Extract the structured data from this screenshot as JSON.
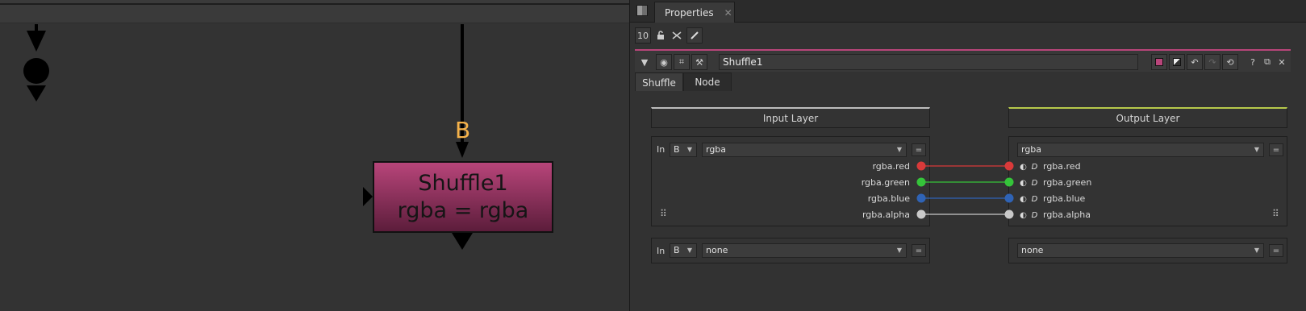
{
  "graph": {
    "input_label": "B",
    "node": {
      "name": "Shuffle1",
      "subtitle": "rgba = rgba"
    }
  },
  "properties": {
    "tab": {
      "label": "Properties",
      "close": "✕"
    },
    "toolbar": {
      "count": "10"
    },
    "node_name": "Shuffle1",
    "subtabs": [
      "Shuffle",
      "Node"
    ],
    "input_layer": {
      "title": "Input Layer"
    },
    "output_layer": {
      "title": "Output Layer"
    },
    "groups": [
      {
        "in_label": "In",
        "input_select": "B",
        "input_layer_value": "rgba",
        "output_layer_value": "rgba",
        "channels_in": [
          "rgba.red",
          "rgba.green",
          "rgba.blue",
          "rgba.alpha"
        ],
        "channels_out": [
          "rgba.red",
          "rgba.green",
          "rgba.blue",
          "rgba.alpha"
        ],
        "colors": [
          "#d93a3a",
          "#35c43a",
          "#2f63b5",
          "#c9c9c9"
        ]
      },
      {
        "in_label": "In",
        "input_select": "B",
        "input_layer_value": "none",
        "output_layer_value": "none"
      }
    ],
    "eq_symbol": "="
  },
  "colors": {
    "node_fill": "#b8457a",
    "input_label": "#f5b24a",
    "output_accent": "#b7c94b"
  }
}
